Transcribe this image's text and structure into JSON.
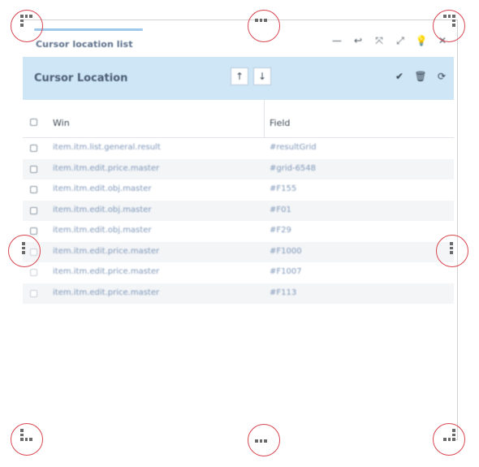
{
  "window": {
    "title": "Cursor location list",
    "controls": [
      {
        "icon": "minimize-icon",
        "glyph": "—"
      },
      {
        "icon": "undo-icon",
        "glyph": "↩"
      },
      {
        "icon": "shrink-icon",
        "glyph": "⤧"
      },
      {
        "icon": "expand-icon",
        "glyph": "⤢"
      },
      {
        "icon": "lightbulb-icon",
        "glyph": "💡"
      },
      {
        "icon": "close-icon",
        "glyph": "✕"
      }
    ]
  },
  "header": {
    "title": "Cursor Location",
    "up_glyph": "↑",
    "down_glyph": "↓",
    "actions": [
      {
        "icon": "check-icon",
        "glyph": "✔"
      },
      {
        "icon": "trash-icon",
        "glyph": "🗑"
      },
      {
        "icon": "refresh-icon",
        "glyph": "⟳"
      }
    ]
  },
  "table": {
    "columns": [
      "Win",
      "Field"
    ],
    "rows": [
      {
        "win": "item.itm.list.general.result",
        "field": "#resultGrid"
      },
      {
        "win": "item.itm.edit.price.master",
        "field": "#grid-6548"
      },
      {
        "win": "item.itm.edit.obj.master",
        "field": "#F155"
      },
      {
        "win": "item.itm.edit.obj.master",
        "field": "#F01"
      },
      {
        "win": "item.itm.edit.obj.master",
        "field": "#F29"
      },
      {
        "win": "item.itm.edit.price.master",
        "field": "#F1000"
      },
      {
        "win": "item.itm.edit.price.master",
        "field": "#F1007"
      },
      {
        "win": "item.itm.edit.price.master",
        "field": "#F113"
      }
    ]
  },
  "colors": {
    "header_bg": "#cfe6f7",
    "handle_ring": "#d8454f",
    "row_text": "#7e96b8"
  }
}
